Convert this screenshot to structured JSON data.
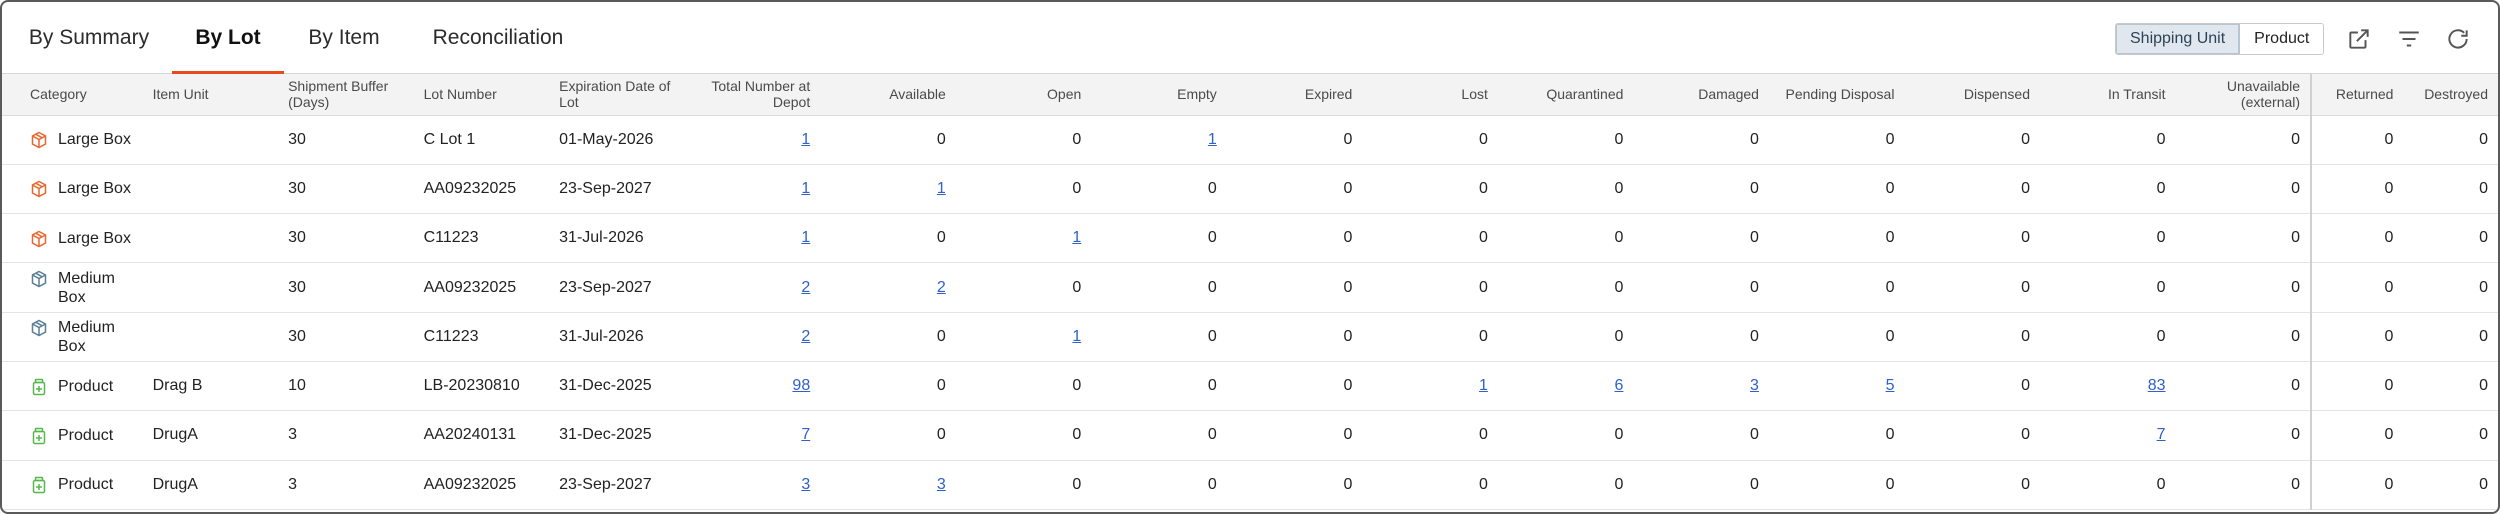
{
  "tabs": [
    {
      "label": "By Summary",
      "active": false
    },
    {
      "label": "By Lot",
      "active": true
    },
    {
      "label": "By Item",
      "active": false
    },
    {
      "label": "Reconciliation",
      "active": false
    }
  ],
  "view_toggle": {
    "shipping_unit": "Shipping Unit",
    "product": "Product",
    "selected": "Shipping Unit"
  },
  "toolbar_icons": [
    "export-icon",
    "filter-icon",
    "refresh-icon"
  ],
  "accent_color": "#e8491d",
  "link_color": "#2f61c6",
  "table": {
    "columns": [
      "Category",
      "Item Unit",
      "Shipment Buffer (Days)",
      "Lot Number",
      "Expiration Date of Lot",
      "Total Number at Depot",
      "Available",
      "Open",
      "Empty",
      "Expired",
      "Lost",
      "Quarantined",
      "Damaged",
      "Pending Disposal",
      "Dispensed",
      "In Transit",
      "Unavailable (external)",
      "Returned",
      "Destroyed"
    ],
    "rows": [
      {
        "icon": "large-box-icon",
        "category": "Large Box",
        "item_unit": "",
        "buffer": "30",
        "lot": "C Lot 1",
        "expiration": "01-May-2026",
        "counts": [
          "1",
          "0",
          "0",
          "1",
          "0",
          "0",
          "0",
          "0",
          "0",
          "0",
          "0",
          "0",
          "0",
          "0"
        ],
        "links": [
          true,
          false,
          false,
          true,
          false,
          false,
          false,
          false,
          false,
          false,
          false,
          false,
          false,
          false
        ]
      },
      {
        "icon": "large-box-icon",
        "category": "Large Box",
        "item_unit": "",
        "buffer": "30",
        "lot": "AA09232025",
        "expiration": "23-Sep-2027",
        "counts": [
          "1",
          "1",
          "0",
          "0",
          "0",
          "0",
          "0",
          "0",
          "0",
          "0",
          "0",
          "0",
          "0",
          "0"
        ],
        "links": [
          true,
          true,
          false,
          false,
          false,
          false,
          false,
          false,
          false,
          false,
          false,
          false,
          false,
          false
        ]
      },
      {
        "icon": "large-box-icon",
        "category": "Large Box",
        "item_unit": "",
        "buffer": "30",
        "lot": "C11223",
        "expiration": "31-Jul-2026",
        "counts": [
          "1",
          "0",
          "1",
          "0",
          "0",
          "0",
          "0",
          "0",
          "0",
          "0",
          "0",
          "0",
          "0",
          "0"
        ],
        "links": [
          true,
          false,
          true,
          false,
          false,
          false,
          false,
          false,
          false,
          false,
          false,
          false,
          false,
          false
        ]
      },
      {
        "icon": "medium-box-icon",
        "category": "Medium Box",
        "item_unit": "",
        "buffer": "30",
        "lot": "AA09232025",
        "expiration": "23-Sep-2027",
        "counts": [
          "2",
          "2",
          "0",
          "0",
          "0",
          "0",
          "0",
          "0",
          "0",
          "0",
          "0",
          "0",
          "0",
          "0"
        ],
        "links": [
          true,
          true,
          false,
          false,
          false,
          false,
          false,
          false,
          false,
          false,
          false,
          false,
          false,
          false
        ]
      },
      {
        "icon": "medium-box-icon",
        "category": "Medium Box",
        "item_unit": "",
        "buffer": "30",
        "lot": "C11223",
        "expiration": "31-Jul-2026",
        "counts": [
          "2",
          "0",
          "1",
          "0",
          "0",
          "0",
          "0",
          "0",
          "0",
          "0",
          "0",
          "0",
          "0",
          "0"
        ],
        "links": [
          true,
          false,
          true,
          false,
          false,
          false,
          false,
          false,
          false,
          false,
          false,
          false,
          false,
          false
        ]
      },
      {
        "icon": "product-bottle-icon",
        "category": "Product",
        "item_unit": "Drag B",
        "buffer": "10",
        "lot": "LB-20230810",
        "expiration": "31-Dec-2025",
        "counts": [
          "98",
          "0",
          "0",
          "0",
          "0",
          "1",
          "6",
          "3",
          "5",
          "0",
          "83",
          "0",
          "0",
          "0"
        ],
        "links": [
          true,
          false,
          false,
          false,
          false,
          true,
          true,
          true,
          true,
          false,
          true,
          false,
          false,
          false
        ]
      },
      {
        "icon": "product-bottle-icon",
        "category": "Product",
        "item_unit": "DrugA",
        "buffer": "3",
        "lot": "AA20240131",
        "expiration": "31-Dec-2025",
        "counts": [
          "7",
          "0",
          "0",
          "0",
          "0",
          "0",
          "0",
          "0",
          "0",
          "0",
          "7",
          "0",
          "0",
          "0"
        ],
        "links": [
          true,
          false,
          false,
          false,
          false,
          false,
          false,
          false,
          false,
          false,
          true,
          false,
          false,
          false
        ]
      },
      {
        "icon": "product-bottle-icon",
        "category": "Product",
        "item_unit": "DrugA",
        "buffer": "3",
        "lot": "AA09232025",
        "expiration": "23-Sep-2027",
        "counts": [
          "3",
          "3",
          "0",
          "0",
          "0",
          "0",
          "0",
          "0",
          "0",
          "0",
          "0",
          "0",
          "0",
          "0"
        ],
        "links": [
          true,
          true,
          false,
          false,
          false,
          false,
          false,
          false,
          false,
          false,
          false,
          false,
          false,
          false
        ]
      }
    ]
  }
}
